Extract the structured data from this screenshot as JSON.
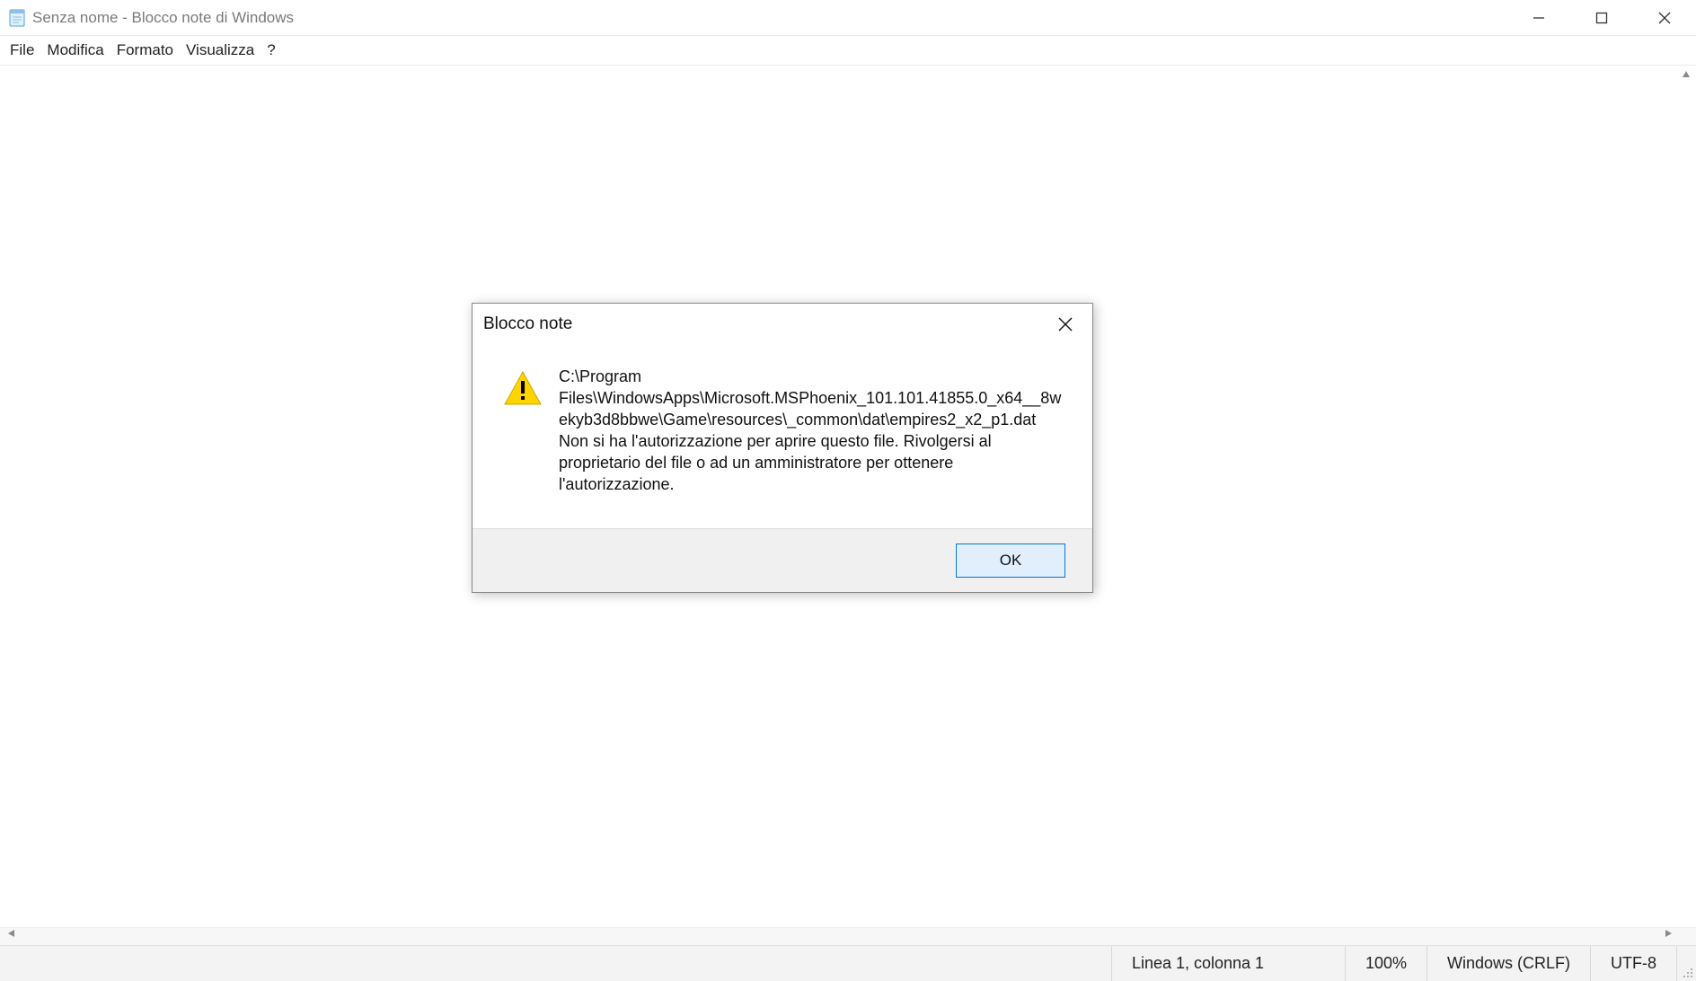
{
  "window": {
    "title": "Senza nome - Blocco note di Windows"
  },
  "menu": {
    "file": "File",
    "edit": "Modifica",
    "format": "Formato",
    "view": "Visualizza",
    "help": "?"
  },
  "status": {
    "position": "Linea 1, colonna 1",
    "zoom": "100%",
    "lineend": "Windows (CRLF)",
    "encoding": "UTF-8"
  },
  "dialog": {
    "title": "Blocco note",
    "message": "C:\\Program Files\\WindowsApps\\Microsoft.MSPhoenix_101.101.41855.0_x64__8wekyb3d8bbwe\\Game\\resources\\_common\\dat\\empires2_x2_p1.dat\nNon si ha l'autorizzazione per aprire questo file. Rivolgersi al proprietario del file o ad un amministratore per ottenere l'autorizzazione.",
    "ok": "OK"
  }
}
